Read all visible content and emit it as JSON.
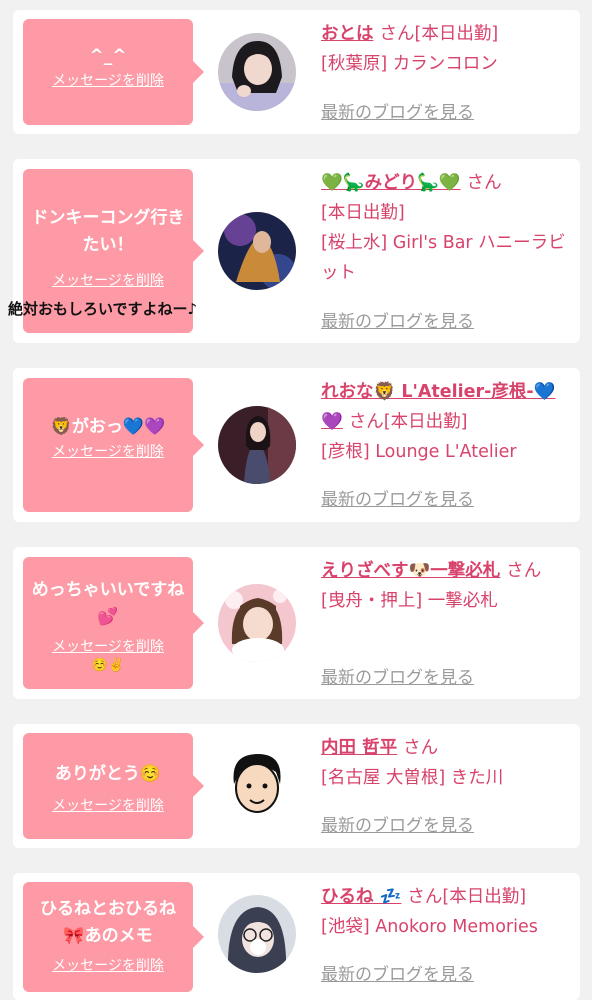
{
  "delete_label": "メッセージを削除",
  "blog_label": "最新のブログを見る",
  "san_label": "さん",
  "overlay_caption": "絶対おもしろいですよねー♪",
  "cards": [
    {
      "bubble": "^_^",
      "name": "おとは",
      "status": "[本日出勤]",
      "shop": "[秋葉原] カランコロン"
    },
    {
      "bubble": "ドンキーコング行きたい！",
      "name": "💚🦕みどり🦕💚",
      "status": "[本日出勤]",
      "shop": "[桜上水] Girl's Bar ハニーラビット"
    },
    {
      "bubble": "🦁がおっ💙💜",
      "name": "れおな🦁 L'Atelier-彦根-💙💜",
      "status": "[本日出勤]",
      "shop": "[彦根] Lounge L'Atelier"
    },
    {
      "bubble": "めっちゃいいですね💕",
      "bubble_extra": "☺️✌️",
      "name": "えりざべす🐶一撃必札",
      "shop": "[曳舟・押上] 一撃必札"
    },
    {
      "bubble": "ありがとう☺️",
      "name": "内田 哲平",
      "shop": "[名古屋 大曽根] きた川"
    },
    {
      "bubble": "ひるねとおひるね🎀あのメモ",
      "name": "ひるね 💤",
      "status": "[本日出勤]",
      "shop": "[池袋] Anokoro Memories"
    }
  ]
}
